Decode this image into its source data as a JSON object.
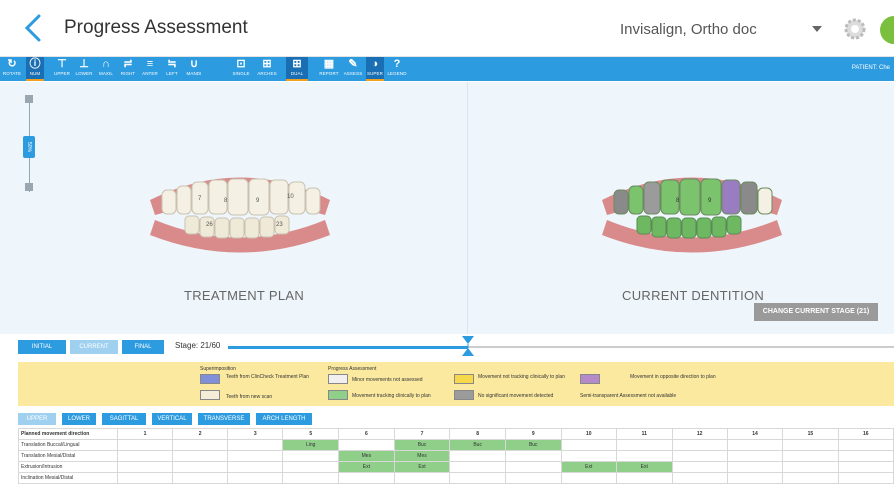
{
  "header": {
    "title": "Progress Assessment",
    "account": "Invisalign, Ortho doc"
  },
  "toolbar": {
    "items": [
      {
        "label": "ROTATE",
        "icon": "rotate-icon"
      },
      {
        "label": "NUM",
        "icon": "info-icon",
        "active": true
      },
      {
        "label": "UPPER",
        "icon": "upper-icon"
      },
      {
        "label": "LOWER",
        "icon": "lower-icon"
      },
      {
        "label": "MAXIL",
        "icon": "maxil-icon"
      },
      {
        "label": "RIGHT",
        "icon": "right-icon"
      },
      {
        "label": "ANTER",
        "icon": "anter-icon"
      },
      {
        "label": "LEFT",
        "icon": "left-icon"
      },
      {
        "label": "MANDI",
        "icon": "mandi-icon"
      },
      {
        "label": "SINGLE",
        "icon": "single-icon"
      },
      {
        "label": "ARCHES",
        "icon": "arches-icon"
      },
      {
        "label": "DUAL",
        "icon": "dual-icon",
        "active": true
      },
      {
        "label": "REPORT",
        "icon": "report-icon"
      },
      {
        "label": "ASSESS",
        "icon": "assess-icon"
      },
      {
        "label": "SUPER",
        "icon": "super-icon"
      },
      {
        "label": "LEGEND",
        "icon": "legend-icon"
      }
    ],
    "patient": "PATIENT: Che"
  },
  "view": {
    "left_label": "TREATMENT PLAN",
    "right_label": "CURRENT DENTITION",
    "change_stage_button": "CHANGE CURRENT STAGE (21)",
    "slider_label": "50%",
    "teeth_left": [
      "7",
      "8",
      "9",
      "10",
      "26",
      "23"
    ],
    "teeth_right": [
      "8",
      "9"
    ]
  },
  "stage": {
    "initial": "INITIAL",
    "current": "CURRENT",
    "final": "FINAL",
    "label": "Stage:  21/60"
  },
  "legend": {
    "superimposition_title": "Superimposition",
    "clincheck": "Teeth from ClinCheck Treatment Plan",
    "new_scan": "Teeth from new scan",
    "progress_title": "Progress Assessment",
    "minor": "Minor movements not assessed",
    "tracking": "Movement tracking clinically to plan",
    "not_tracking": "Movement not tracking clinically to plan",
    "no_movement": "No significant movement detected",
    "opposite": "Movement in opposite direction to plan",
    "semi": "Semi-transparent  Assessment not available",
    "colors": {
      "clincheck": "#7f8fd8",
      "new_scan": "#f6edd8",
      "minor": "#f2f0ee",
      "tracking": "#8fcf8a",
      "not_tracking": "#f7d84a",
      "no_movement": "#9b9b9b",
      "opposite": "#b48ac8"
    }
  },
  "tabs": [
    "UPPER",
    "LOWER",
    "SAGITTAL",
    "VERTICAL",
    "TRANSVERSE",
    "ARCH LENGTH"
  ],
  "table": {
    "header": [
      "Planned movement direction",
      "1",
      "2",
      "3",
      "5",
      "6",
      "7",
      "8",
      "9",
      "10",
      "11",
      "12",
      "14",
      "15",
      "16"
    ],
    "rows": [
      {
        "label": "Translation Buccal/Lingual",
        "cells": [
          "",
          "",
          "",
          "Ling",
          "",
          "Buc",
          "Buc",
          "Buc",
          "",
          "",
          "",
          "",
          "",
          ""
        ]
      },
      {
        "label": "Translation Mesial/Distal",
        "cells": [
          "",
          "",
          "",
          "",
          "Mes",
          "Mes",
          "",
          "",
          "",
          "",
          "",
          "",
          "",
          ""
        ]
      },
      {
        "label": "Extrusion/Intrusion",
        "cells": [
          "",
          "",
          "",
          "",
          "Ext",
          "Ext",
          "",
          "",
          "Ext",
          "Ext",
          "",
          "",
          "",
          ""
        ]
      },
      {
        "label": "Inclination Mesial/Distal",
        "cells": [
          "",
          "",
          "",
          "",
          "",
          "",
          "",
          "",
          "",
          "",
          "",
          "",
          "",
          ""
        ]
      }
    ]
  }
}
